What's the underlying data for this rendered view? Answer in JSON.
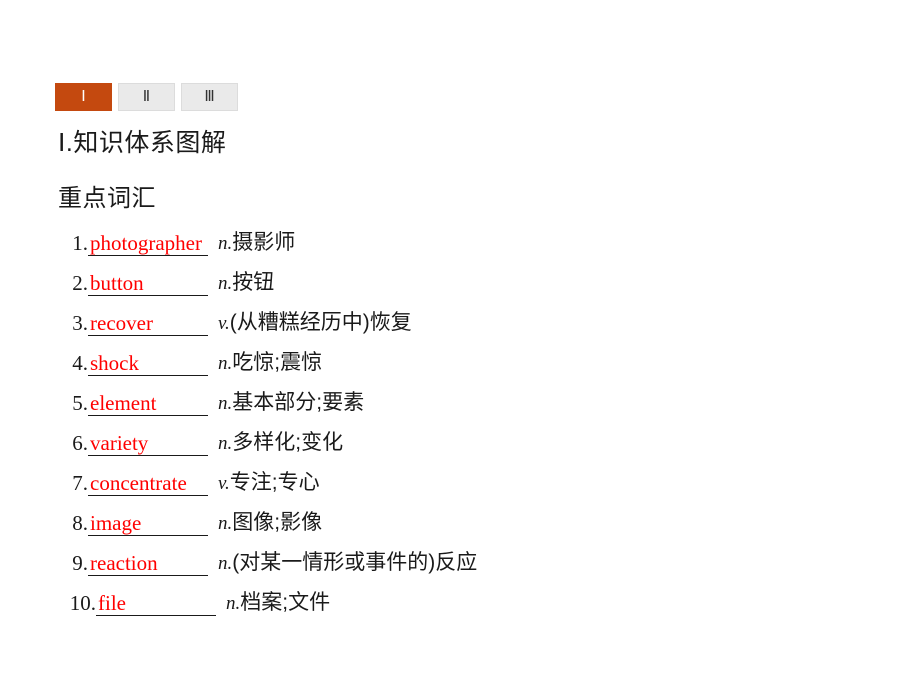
{
  "tabs": [
    {
      "label": "Ⅰ",
      "active": true
    },
    {
      "label": "Ⅱ",
      "active": false
    },
    {
      "label": "Ⅲ",
      "active": false
    }
  ],
  "headings": {
    "section_title": "Ⅰ.知识体系图解",
    "sub_title": "重点词汇"
  },
  "colors": {
    "active_tab_background": "#c4490f",
    "active_tab_text": "#ffffff",
    "inactive_tab_background": "#eaeaea",
    "answer_word": "#ff0000",
    "body_text": "#1a1a1a",
    "page_background": "#ffffff"
  },
  "vocabulary": [
    {
      "index": "1.",
      "word": "photographer",
      "pos": "n.",
      "meaning": "摄影师"
    },
    {
      "index": "2.",
      "word": "button",
      "pos": "n.",
      "meaning": "按钮"
    },
    {
      "index": "3.",
      "word": "recover",
      "pos": "v.",
      "meaning": "(从糟糕经历中)恢复"
    },
    {
      "index": "4.",
      "word": "shock",
      "pos": "n.",
      "meaning": "吃惊;震惊"
    },
    {
      "index": "5.",
      "word": "element",
      "pos": "n.",
      "meaning": "基本部分;要素"
    },
    {
      "index": "6.",
      "word": "variety",
      "pos": "n.",
      "meaning": "多样化;变化"
    },
    {
      "index": "7.",
      "word": "concentrate",
      "pos": "v.",
      "meaning": "专注;专心"
    },
    {
      "index": "8.",
      "word": "image",
      "pos": "n.",
      "meaning": "图像;影像"
    },
    {
      "index": "9.",
      "word": "reaction",
      "pos": "n.",
      "meaning": "(对某一情形或事件的)反应"
    },
    {
      "index": "10.",
      "word": "file",
      "pos": "n.",
      "meaning": "档案;文件"
    }
  ]
}
